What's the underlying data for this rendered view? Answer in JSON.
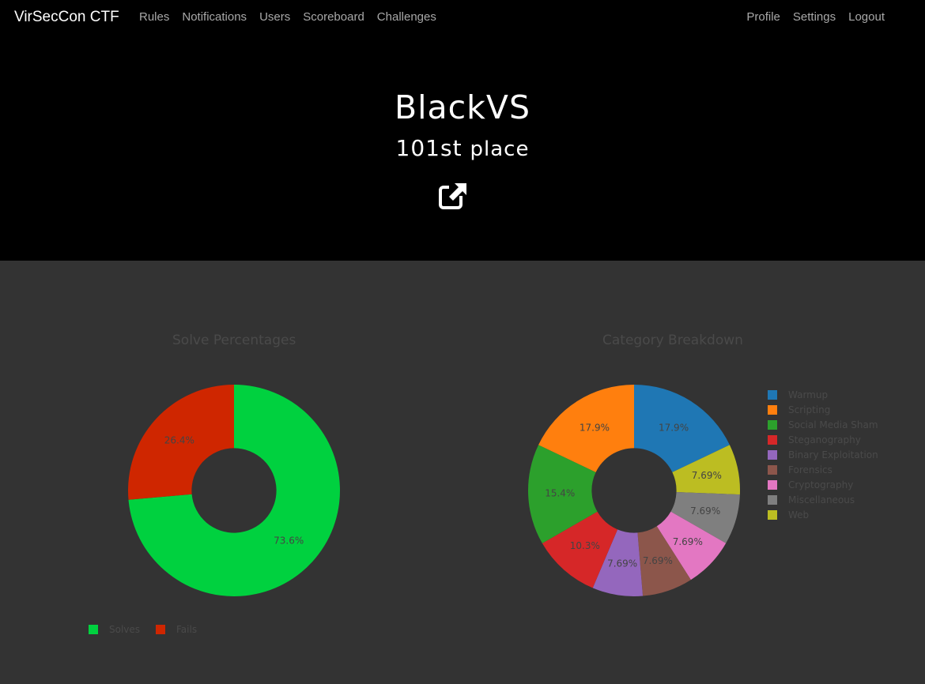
{
  "nav": {
    "brand": "VirSecCon CTF",
    "left_links": [
      "Rules",
      "Notifications",
      "Users",
      "Scoreboard",
      "Challenges"
    ],
    "right_links": [
      "Profile",
      "Settings",
      "Logout"
    ]
  },
  "header": {
    "team_name": "BlackVS",
    "place_number": "101",
    "place_suffix": "st",
    "place_word": "place",
    "link_icon": "external-link-icon"
  },
  "colors": {
    "background": "#333333",
    "header_bg": "#000000",
    "solves": "#00d13f",
    "fails": "#cf2600"
  },
  "chart_data": [
    {
      "type": "pie",
      "title": "Solve Percentages",
      "categories": [
        "Solves",
        "Fails"
      ],
      "values": [
        73.6,
        26.4
      ],
      "labels": [
        "73.6%",
        "26.4%"
      ],
      "colors": [
        "#00d13f",
        "#cf2600"
      ],
      "legend": "bottom-left",
      "hole": 0.4
    },
    {
      "type": "pie",
      "title": "Category Breakdown",
      "categories": [
        "Warmup",
        "Scripting",
        "Social Media Sham",
        "Steganography",
        "Binary Exploitation",
        "Forensics",
        "Cryptography",
        "Miscellaneous",
        "Web"
      ],
      "values": [
        17.9,
        17.9,
        15.4,
        10.3,
        7.69,
        7.69,
        7.69,
        7.69,
        7.69
      ],
      "labels": [
        "17.9%",
        "17.9%",
        "15.4%",
        "10.3%",
        "7.69%",
        "7.69%",
        "7.69%",
        "7.69%",
        "7.69%"
      ],
      "order": [
        "Warmup",
        "Web",
        "Miscellaneous",
        "Cryptography",
        "Forensics",
        "Binary Exploitation",
        "Steganography",
        "Social Media Sham",
        "Scripting"
      ],
      "colors": [
        "#1f77b4",
        "#ff7f0e",
        "#2ca02c",
        "#d62728",
        "#9467bd",
        "#8c564b",
        "#e377c2",
        "#7f7f7f",
        "#bcbd22"
      ],
      "legend": "right",
      "hole": 0.4
    }
  ]
}
